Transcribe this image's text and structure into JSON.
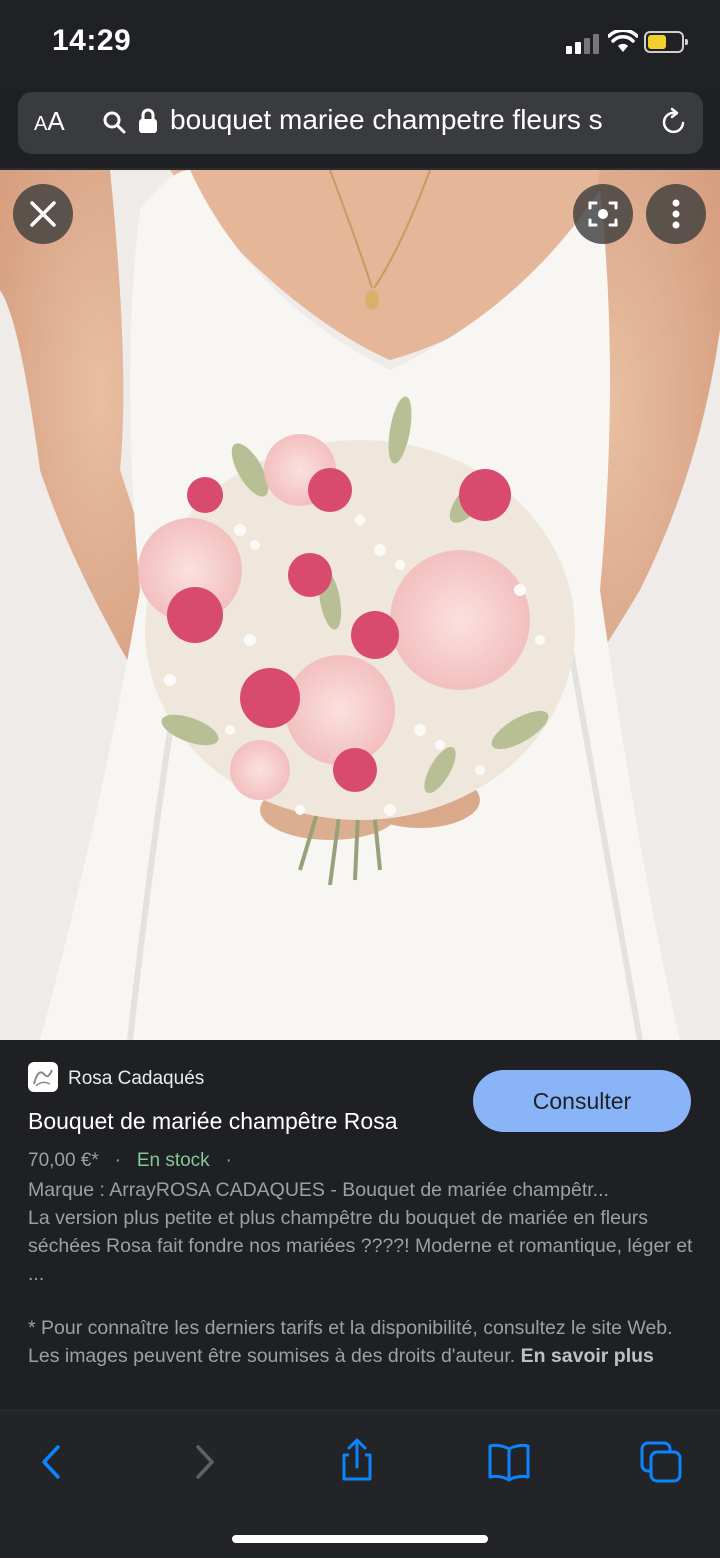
{
  "status_bar": {
    "time": "14:29"
  },
  "url_bar": {
    "aa_label_small": "A",
    "aa_label_large": "A",
    "url_text": "bouquet mariee champetre fleurs s"
  },
  "result": {
    "source_name": "Rosa Cadaqués",
    "title": "Bouquet de mariée champêtre Rosa",
    "price": "70,00 €*",
    "dot1": "·",
    "availability": "En stock",
    "dot2": "·",
    "description_line": "Marque : ArrayROSA CADAQUES - Bouquet de mariée champêtr...",
    "description_body": "La version plus petite et plus champêtre du bouquet de mariée en fleurs séchées Rosa fait fondre nos mariées ????! Moderne et romantique, léger et ...",
    "disclaimer": "* Pour connaître les derniers tarifs et la disponibilité, consultez le site Web. Les images peuvent être soumises à des droits d'auteur.",
    "learn_more": "En savoir plus",
    "consult_button": "Consulter"
  },
  "colors": {
    "accent_button": "#8ab4f8",
    "in_stock": "#81c995",
    "safari_blue": "#0a84ff",
    "battery": "#f4d02c"
  },
  "icons": {
    "close": "close-icon",
    "lens": "lens-icon",
    "more": "more-vert-icon",
    "back": "back-icon",
    "forward": "forward-icon",
    "share": "share-icon",
    "bookmarks": "bookmarks-icon",
    "tabs": "tabs-icon"
  }
}
